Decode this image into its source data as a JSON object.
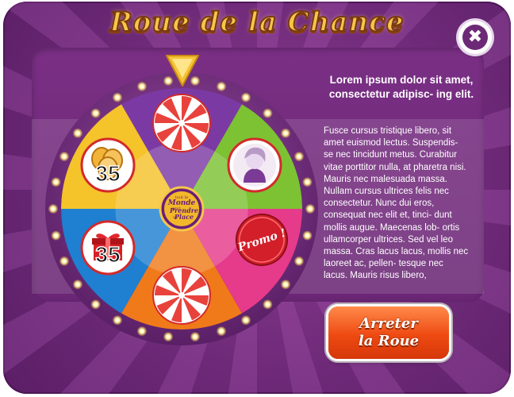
{
  "dialog": {
    "title": "Roue de la Chance",
    "close_symbol": "✖"
  },
  "wheel": {
    "segments": [
      {
        "color": "#7b3aa3",
        "content": "candy-icon"
      },
      {
        "color": "#7cc233",
        "content": "avatar-icon"
      },
      {
        "color": "#e63a8a",
        "content": "promo-sticker-icon"
      },
      {
        "color": "#f07a1a",
        "content": "candy-icon"
      },
      {
        "color": "#1f7fd1",
        "content": "gift-icon"
      },
      {
        "color": "#f5c32a",
        "content": "coins-icon"
      }
    ],
    "coins_amount": "35",
    "gift_amount": "35",
    "promo_label": "Promo !",
    "hub_lines": [
      "tout le",
      "Monde",
      "veut",
      "Prendre",
      "sa",
      "Place"
    ]
  },
  "info": {
    "heading": "Lorem ipsum dolor sit amet, consectetur adipisc- ing elit.",
    "body": "Fusce cursus tristique libero, sit amet euismod lectus. Suspendis- se nec tincidunt metus. Curabitur vitae porttitor nulla, at pharetra nisi. Mauris nec malesuada massa. Nullam cursus ultrices felis nec consectetur. Nunc dui eros, consequat nec elit et, tinci- dunt mollis augue. Maecenas lob- ortis ullamcorper ultrices. Sed vel leo massa. Cras lacus lacus, mollis nec laoreet ac, pellen- tesque nec lacus. Mauris risus libero,"
  },
  "stop_button": {
    "line1": "Arreter",
    "line2": "la Roue"
  },
  "colors": {
    "frame": "#6e2a78",
    "title": "#f6c64a",
    "button": "#ee4a12"
  }
}
